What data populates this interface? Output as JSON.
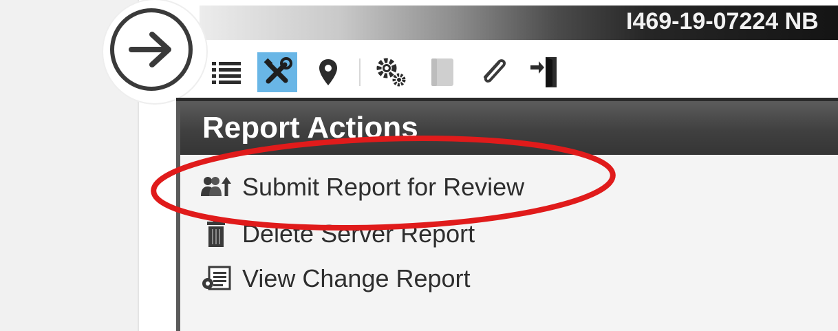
{
  "header": {
    "title": "I469-19-07224 NB"
  },
  "toolbar": {
    "items": [
      {
        "icon": "list-icon",
        "active": false
      },
      {
        "icon": "tools-icon",
        "active": true
      },
      {
        "icon": "location-pin-icon",
        "active": false
      },
      {
        "icon": "gears-icon",
        "active": false
      },
      {
        "icon": "book-icon",
        "active": false
      },
      {
        "icon": "paperclip-icon",
        "active": false
      },
      {
        "icon": "exit-door-icon",
        "active": false
      }
    ],
    "active_color": "#69b6e6"
  },
  "nav_button": {
    "icon": "arrow-right-circle-icon"
  },
  "panel": {
    "title": "Report Actions",
    "actions": [
      {
        "icon": "users-upload-icon",
        "label": "Submit Report for Review"
      },
      {
        "icon": "trash-icon",
        "label": "Delete Server Report"
      },
      {
        "icon": "report-change-icon",
        "label": "View Change Report"
      }
    ]
  },
  "annotation": {
    "color": "#e01b1b",
    "target": "Submit Report for Review"
  }
}
